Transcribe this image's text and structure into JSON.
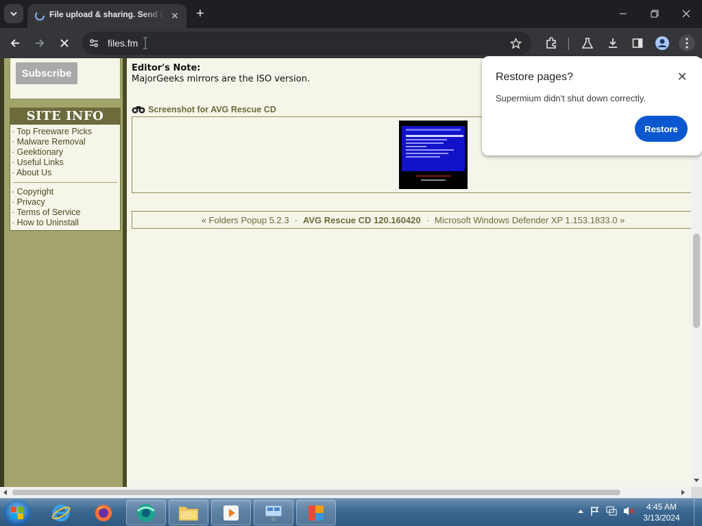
{
  "browser": {
    "tab_title": "File upload & sharing. Send large files",
    "url": "files.fm"
  },
  "sidebar": {
    "subscribe_label": "Subscribe",
    "site_info_title": "SITE INFO",
    "links_group1": [
      "Top Freeware Picks",
      "Malware Removal",
      "Geektionary",
      "Useful Links",
      "About Us"
    ],
    "links_group2": [
      "Copyright",
      "Privacy",
      "Terms of Service",
      "How to Uninstall"
    ]
  },
  "content": {
    "editor_note_heading": "Editor's Note:",
    "editor_note_text": "MajorGeeks mirrors are the ISO version.",
    "screenshot_title": "Screenshot for AVG Rescue CD",
    "nav_prev": "« Folders Popup 5.2.3",
    "nav_current": "AVG Rescue CD 120.160420",
    "nav_next": "Microsoft Windows Defender XP 1.153.1833.0 »",
    "nav_sep": "·"
  },
  "popup": {
    "title": "Restore pages?",
    "message": "Supermium didn't shut down correctly.",
    "button": "Restore"
  },
  "taskbar": {
    "time": "4:45 AM",
    "date": "3/13/2024"
  }
}
